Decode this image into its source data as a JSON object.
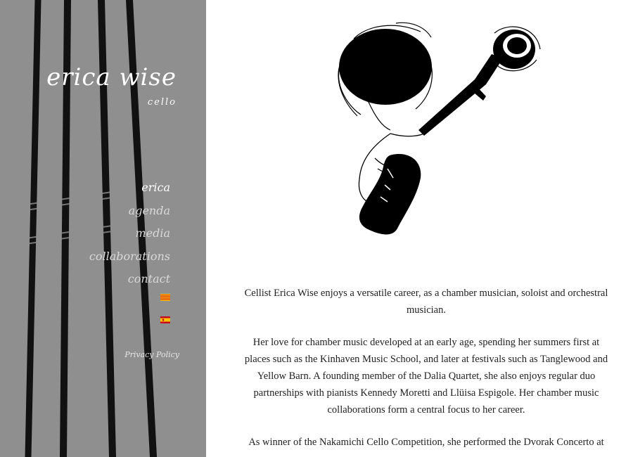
{
  "site": {
    "title": "erica wise",
    "subtitle": "cello"
  },
  "nav": {
    "items": [
      {
        "label": "erica",
        "active": true
      },
      {
        "label": "agenda",
        "active": false
      },
      {
        "label": "media",
        "active": false
      },
      {
        "label": "collaborations",
        "active": false
      },
      {
        "label": "contact",
        "active": false
      }
    ],
    "languages": [
      {
        "icon": "catalan-flag-icon"
      },
      {
        "icon": "spanish-flag-icon"
      }
    ],
    "privacy_label": "Privacy Policy"
  },
  "hero": {
    "icon": "cellist-illustration"
  },
  "bio": {
    "paragraphs": [
      "Cellist Erica Wise enjoys a versatile career, as a chamber musician, soloist and orchestral musician.",
      "Her love for chamber music developed at an early age, spending her summers first at places such as the Kinhaven Music School, and later at festivals such as Tanglewood and Yellow Barn. A founding member of the Dalia Quartet, she also enjoys regular duo partnerships with pianists Kennedy Moretti and Llüisa Espigole. Her chamber music collaborations form a central focus to her career.",
      "As winner of the Nakamichi Cello Competition, she performed the Dvorak Concerto at"
    ]
  },
  "colors": {
    "sidebar_bg": "#8f8f8f",
    "content_bg": "#ffffff",
    "text": "#222222",
    "nav_active": "#ffffff",
    "nav_inactive": "#d9d9d9"
  }
}
